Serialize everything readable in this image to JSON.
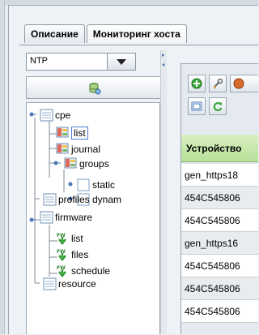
{
  "tabs": [
    {
      "label": "Описание",
      "active": false
    },
    {
      "label": "Мониторинг хоста",
      "active": true
    }
  ],
  "combo": {
    "value": "NTP"
  },
  "tree": {
    "items": [
      {
        "label": "cpe",
        "icon": "list-doc-icon"
      },
      {
        "label": "list",
        "icon": "table-icon",
        "selected": true
      },
      {
        "label": "journal",
        "icon": "table-icon"
      },
      {
        "label": "groups",
        "icon": "table-icon"
      },
      {
        "label": "static",
        "icon": "checkbox-icon"
      },
      {
        "label": "dynam",
        "icon": "checkbox-icon"
      },
      {
        "label": "profiles",
        "icon": "list-doc-icon"
      },
      {
        "label": "firmware",
        "icon": "list-doc-icon"
      },
      {
        "label": "list",
        "icon": "firmware-icon"
      },
      {
        "label": "files",
        "icon": "firmware-icon"
      },
      {
        "label": "schedule",
        "icon": "firmware-icon"
      },
      {
        "label": "resource",
        "icon": "list-doc-icon"
      }
    ],
    "fw_badge": "FW"
  },
  "table": {
    "header": "Устройство",
    "rows": [
      "gen_https18",
      "454C545806",
      "454C545806",
      "gen_https16",
      "454C545806",
      "454C545806",
      "454C545806"
    ]
  },
  "colors": {
    "header_green": "#c6e8a8",
    "selection_border": "#4a7bd0",
    "icon_green": "#3aa83a"
  }
}
